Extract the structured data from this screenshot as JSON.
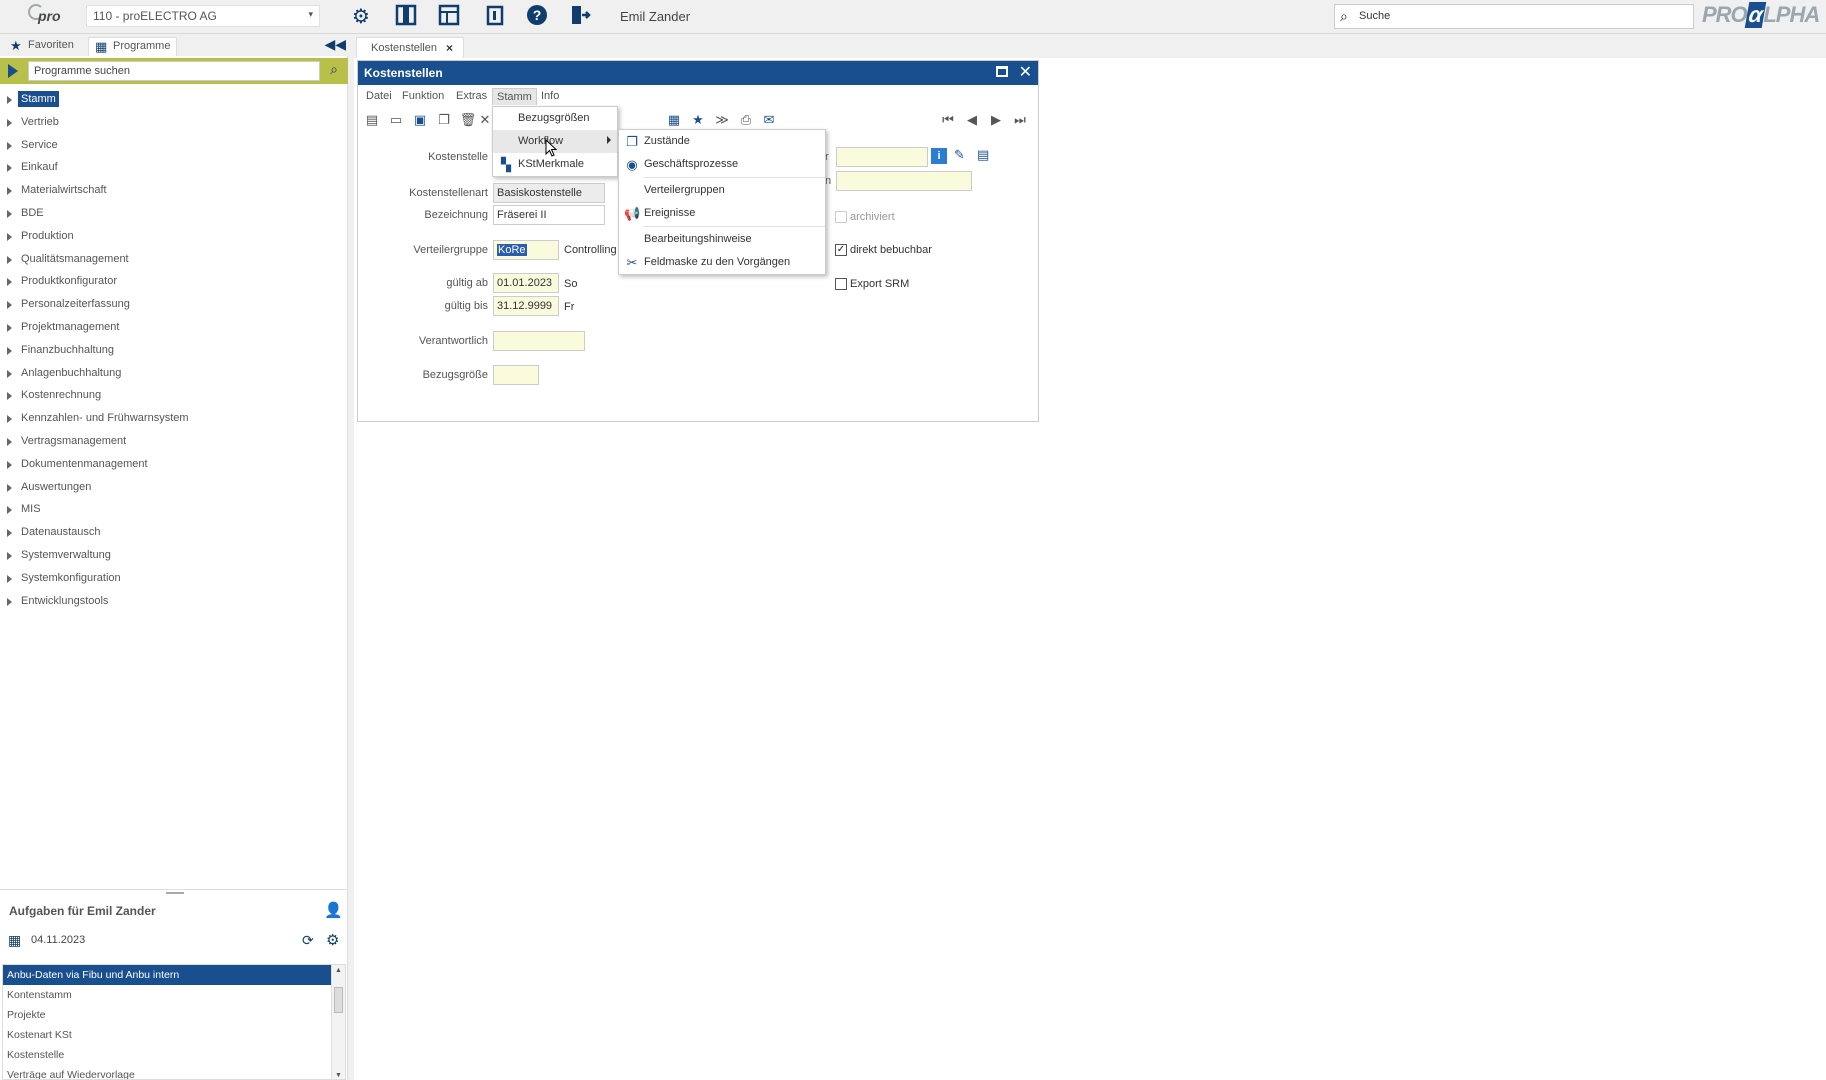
{
  "topbar": {
    "logo_text": "pro",
    "company": "110 - proELECTRO AG",
    "user": "Emil Zander",
    "search_placeholder": "Suche",
    "brand_logo_pre": "PRO",
    "brand_logo_alpha": "α",
    "brand_logo_post": "LPHA",
    "icons": [
      "gear-icon",
      "panel-icon",
      "layout-icon",
      "info-book-icon",
      "help-icon",
      "exit-icon"
    ]
  },
  "leftpanel": {
    "tabs": [
      {
        "label": "Favoriten",
        "icon": "star-icon"
      },
      {
        "label": "Programme",
        "icon": "programs-icon"
      }
    ],
    "program_search_placeholder": "Programme suchen",
    "tree": [
      "Stamm",
      "Vertrieb",
      "Service",
      "Einkauf",
      "Materialwirtschaft",
      "BDE",
      "Produktion",
      "Qualitätsmanagement",
      "Produktkonfigurator",
      "Personalzeiterfassung",
      "Projektmanagement",
      "Finanzbuchhaltung",
      "Anlagenbuchhaltung",
      "Kostenrechnung",
      "Kennzahlen- und Frühwarnsystem",
      "Vertragsmanagement",
      "Dokumentenmanagement",
      "Auswertungen",
      "MIS",
      "Datenaustausch",
      "Systemverwaltung",
      "Systemkonfiguration",
      "Entwicklungstools"
    ],
    "tasks": {
      "title": "Aufgaben für Emil Zander",
      "date": "04.11.2023",
      "items": [
        "Anbu-Daten via Fibu und Anbu intern",
        "Kontenstamm",
        "Projekte",
        "Kostenart KSt",
        "Kostenstelle",
        "Verträge auf Wiedervorlage"
      ]
    }
  },
  "doc_tab": {
    "label": "Kostenstellen"
  },
  "window": {
    "title": "Kostenstellen",
    "menu": [
      "Datei",
      "Funktion",
      "Extras",
      "Stamm",
      "Info"
    ],
    "form": {
      "kostenstelle_label": "Kostenstelle",
      "kostenstellenart_label": "Kostenstellenart",
      "kostenstellenart_value": "Basiskostenstelle",
      "bezeichnung_label": "Bezeichnung",
      "bezeichnung_value": "Fräserei II",
      "verteilergruppe_label": "Verteilergruppe",
      "verteilergruppe_value": "KoRe",
      "verteilergruppe_text": "Controlling",
      "gueltig_ab_label": "gültig ab",
      "gueltig_ab_value": "01.01.2023",
      "gueltig_ab_day": "So",
      "gueltig_bis_label": "gültig bis",
      "gueltig_bis_value": "31.12.9999",
      "gueltig_bis_day": "Fr",
      "verantwortlich_label": "Verantwortlich",
      "bezugsgroesse_label": "Bezugsgröße",
      "archiviert_label": "archiviert",
      "direkt_bebuchbar_label": "direkt bebuchbar",
      "direkt_bebuchbar_checked": "✓",
      "export_srm_label": "Export SRM",
      "right_label_1": "r",
      "right_label_2": "n"
    }
  },
  "stamm_menu": {
    "items": [
      "Bezugsgrößen",
      "Workflow",
      "KStMerkmale"
    ]
  },
  "workflow_menu": {
    "items": [
      "Zustände",
      "Geschäftsprozesse",
      "Verteilergruppen",
      "Ereignisse",
      "Bearbeitungshinweise",
      "Feldmaske zu den Vorgängen"
    ]
  }
}
